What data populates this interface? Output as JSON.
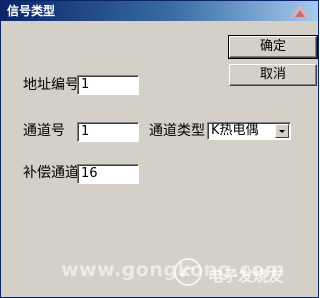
{
  "window": {
    "title": "信号类型"
  },
  "buttons": {
    "ok_label": "确定",
    "cancel_label": "取消"
  },
  "fields": {
    "address": {
      "label": "地址编号",
      "value": "1"
    },
    "channel": {
      "label": "通道号",
      "value": "1"
    },
    "channel_type": {
      "label": "通道类型",
      "value": "K热电偶"
    },
    "compensation": {
      "label": "补偿通道",
      "value": "16"
    }
  },
  "watermark": {
    "url_text": "www.gongkong.com",
    "brand_text": "电子发烧友"
  },
  "colors": {
    "titlebar_start": "#0a246a",
    "titlebar_end": "#a6caf0",
    "dialog_face": "#d4d0c8"
  }
}
